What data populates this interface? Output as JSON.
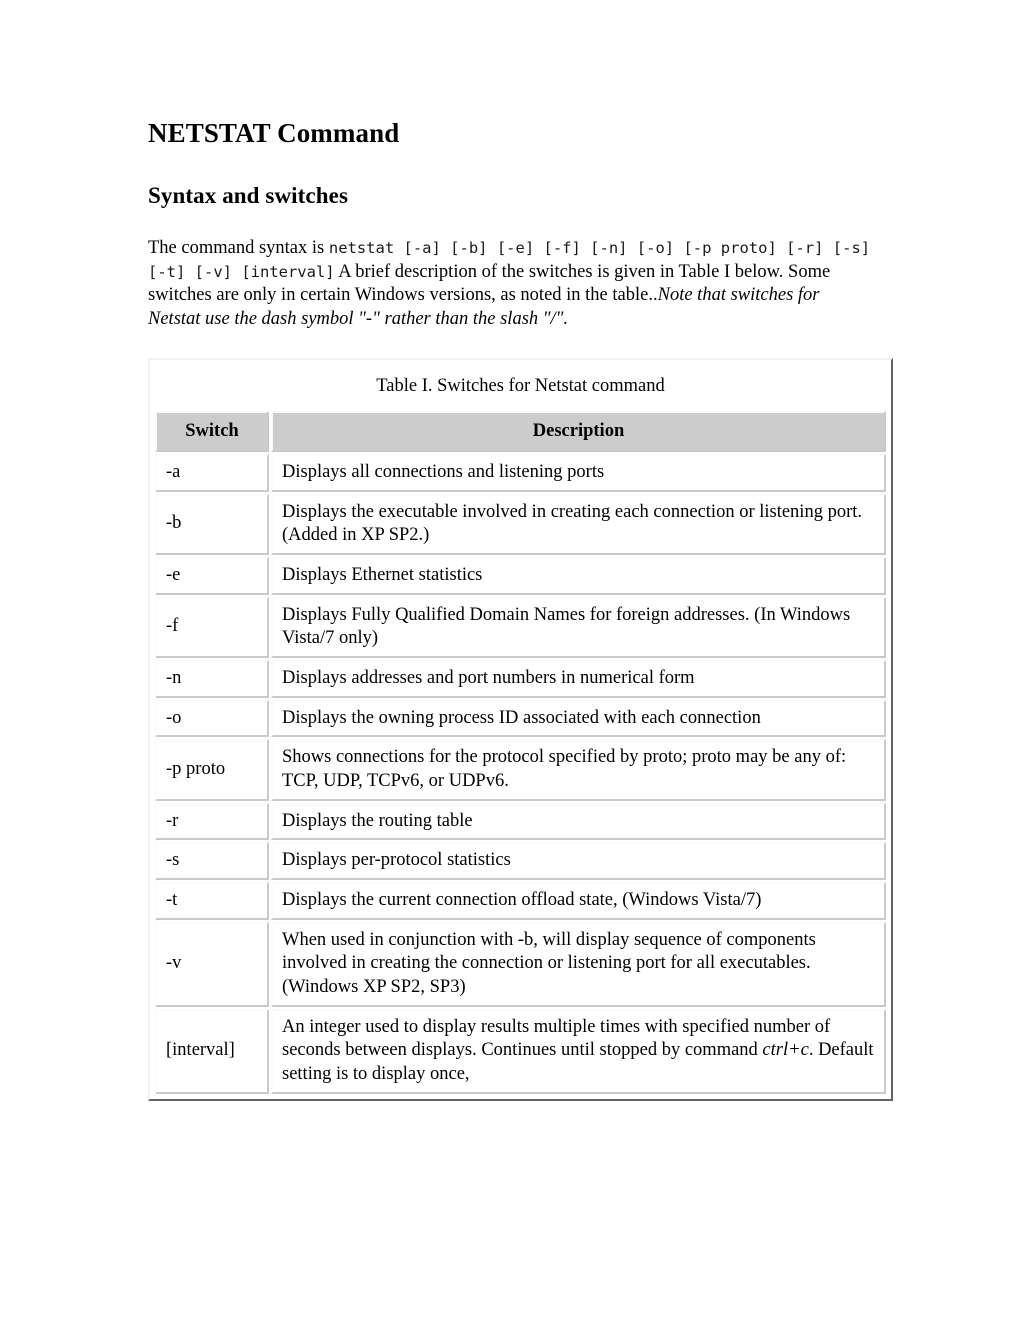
{
  "document": {
    "title": "NETSTAT Command",
    "subtitle": "Syntax and switches",
    "intro": {
      "lead": "The command syntax is ",
      "syntax_code": "netstat [-a] [-b] [-e] [-f] [-n] [-o] [-p proto] [-r] [-s] [-t] [-v] [interval]",
      "after_code": " A brief description of the switches is given in Table I below. Some switches are only in certain Windows versions, as noted in the table..",
      "note_italic": "Note that switches for Netstat use the dash symbol \"-\" rather than the slash \"/\"."
    }
  },
  "table": {
    "caption": "Table I. Switches for Netstat command",
    "headers": {
      "switch": "Switch",
      "description": "Description"
    },
    "header_bg": "#cccccc",
    "rows": [
      {
        "switch": "-a",
        "description": "Displays all connections and listening ports"
      },
      {
        "switch": "-b",
        "description": "Displays the executable involved in creating each connection or listening port. (Added in XP SP2.)"
      },
      {
        "switch": "-e",
        "description": "Displays Ethernet statistics"
      },
      {
        "switch": "-f",
        "description": "Displays Fully Qualified Domain Names for foreign addresses. (In Windows Vista/7 only)"
      },
      {
        "switch": "-n",
        "description": "Displays addresses and port numbers in numerical form"
      },
      {
        "switch": "-o",
        "description": "Displays the owning process ID associated with each connection"
      },
      {
        "switch": "-p proto",
        "description": "Shows connections for the protocol specified by proto; proto may be any of: TCP, UDP, TCPv6, or UDPv6."
      },
      {
        "switch": "-r",
        "description": "Displays the routing table"
      },
      {
        "switch": "-s",
        "description": "Displays per-protocol statistics"
      },
      {
        "switch": "-t",
        "description": "Displays the current connection offload state, (Windows Vista/7)"
      },
      {
        "switch": "-v",
        "description": "When used in conjunction with -b, will display sequence of components involved in creating the connection or listening port for all executables. (Windows XP SP2, SP3)"
      },
      {
        "switch": "[interval]",
        "description_part1": "An integer used to display results multiple times with specified number of seconds between displays. Continues until stopped by command ",
        "description_italic": "ctrl+c",
        "description_part2": ". Default setting is to display once,"
      }
    ]
  }
}
